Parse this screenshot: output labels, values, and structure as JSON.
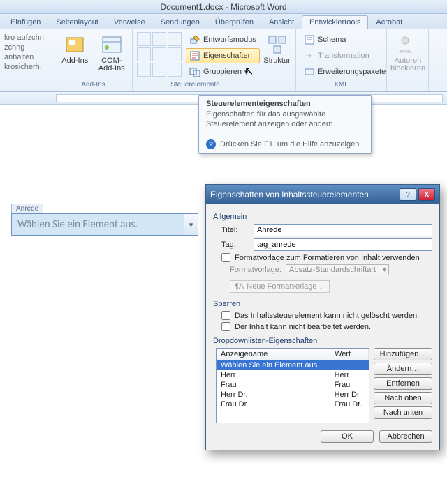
{
  "window": {
    "title": "Document1.docx  -  Microsoft Word"
  },
  "tabs": [
    "Einfügen",
    "Seitenlayout",
    "Verweise",
    "Sendungen",
    "Überprüfen",
    "Ansicht",
    "Entwicklertools",
    "Acrobat"
  ],
  "active_tab_index": 6,
  "ribbon": {
    "group_code": {
      "items": [
        "kro aufzchn.",
        "zchng anhalten",
        "krosicherh."
      ]
    },
    "group_addins": {
      "label": "Add-Ins",
      "addins": "Add-Ins",
      "com": "COM-\nAdd-Ins"
    },
    "group_controls": {
      "label": "Steuerelemente",
      "design": "Entwurfsmodus",
      "properties": "Eigenschaften",
      "group": "Gruppieren"
    },
    "group_struct": {
      "label": "",
      "struct": "Struktur"
    },
    "group_xml": {
      "label": "XML",
      "schema": "Schema",
      "transform": "Transformation",
      "expansion": "Erweiterungspakete"
    },
    "group_protect": {
      "author": "Autoren\nblockieren"
    }
  },
  "screentip": {
    "title": "Steuerelementeigenschaften",
    "body": "Eigenschaften für das ausgewählte Steuerelement anzeigen oder ändern.",
    "help": "Drücken Sie F1, um die Hilfe anzuzeigen."
  },
  "content_control": {
    "tag": "Anrede",
    "placeholder": "Wählen Sie ein Element aus."
  },
  "dialog": {
    "title": "Eigenschaften von Inhaltssteuerelementen",
    "sections": {
      "general": "Allgemein",
      "lock": "Sperren",
      "dropdown": "Dropdownlisten-Eigenschaften"
    },
    "fields": {
      "title_label": "Titel:",
      "title_value": "Anrede",
      "tag_label": "Tag:",
      "tag_value": "tag_anrede",
      "usestyle": "Formatvorlage zum Formatieren von Inhalt verwenden",
      "style_label": "Formatvorlage:",
      "style_value": "Absatz-Standardschriftart",
      "newstyle": "Neue Formatvorlage…",
      "lock_delete": "Das Inhaltssteuerelement kann nicht gelöscht werden.",
      "lock_edit": "Der Inhalt kann nicht bearbeitet werden."
    },
    "list": {
      "headers": {
        "name": "Anzeigename",
        "value": "Wert"
      },
      "rows": [
        {
          "name": "Wählen Sie ein Element aus.",
          "value": ""
        },
        {
          "name": "Herr",
          "value": "Herr"
        },
        {
          "name": "Frau",
          "value": "Frau"
        },
        {
          "name": "Herr Dr.",
          "value": "Herr Dr."
        },
        {
          "name": "Frau Dr.",
          "value": "Frau Dr."
        }
      ],
      "selected_index": 0
    },
    "buttons": {
      "add": "Hinzufügen…",
      "edit": "Ändern…",
      "remove": "Entfernen",
      "up": "Nach oben",
      "down": "Nach unten",
      "ok": "OK",
      "cancel": "Abbrechen"
    }
  }
}
